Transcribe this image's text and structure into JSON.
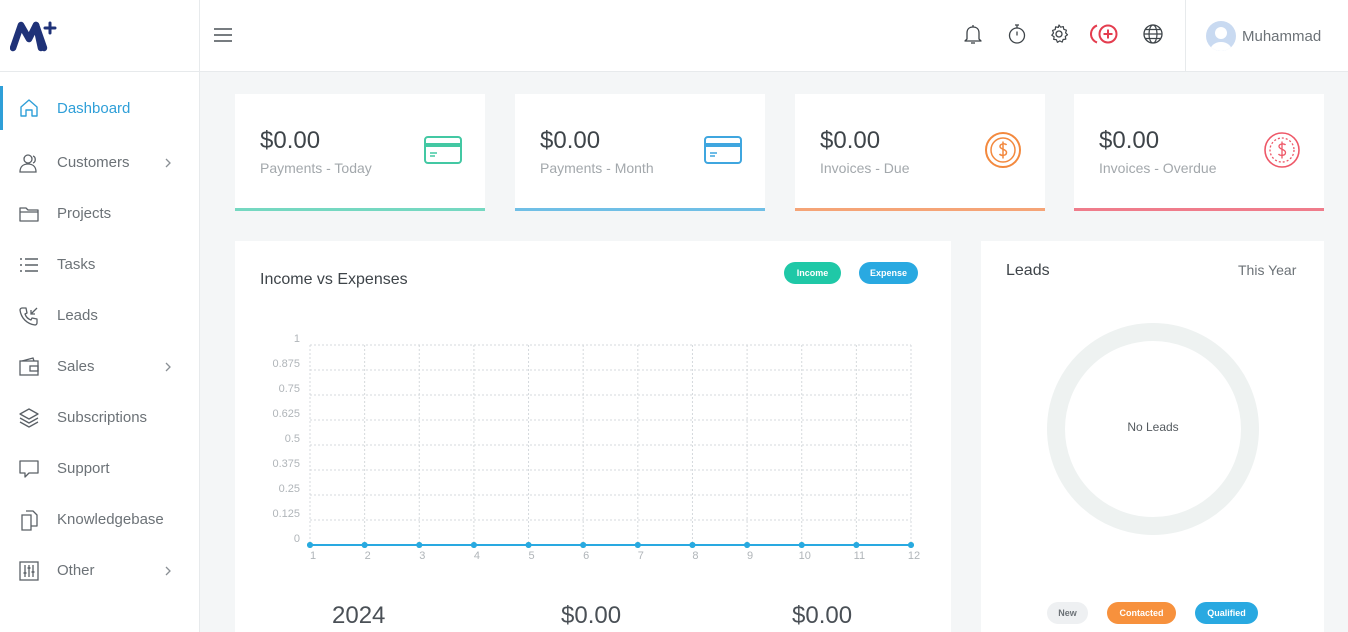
{
  "app": {
    "logo_alt": "brand-logo"
  },
  "sidebar": {
    "items": [
      {
        "label": "Dashboard",
        "icon": "home-icon",
        "active": true,
        "has_submenu": false
      },
      {
        "label": "Customers",
        "icon": "users-icon",
        "active": false,
        "has_submenu": true
      },
      {
        "label": "Projects",
        "icon": "folder-icon",
        "active": false,
        "has_submenu": false
      },
      {
        "label": "Tasks",
        "icon": "list-icon",
        "active": false,
        "has_submenu": false
      },
      {
        "label": "Leads",
        "icon": "phone-incoming-icon",
        "active": false,
        "has_submenu": false
      },
      {
        "label": "Sales",
        "icon": "wallet-icon",
        "active": false,
        "has_submenu": true
      },
      {
        "label": "Subscriptions",
        "icon": "layers-icon",
        "active": false,
        "has_submenu": false
      },
      {
        "label": "Support",
        "icon": "chat-icon",
        "active": false,
        "has_submenu": false
      },
      {
        "label": "Knowledgebase",
        "icon": "document-icon",
        "active": false,
        "has_submenu": false
      },
      {
        "label": "Other",
        "icon": "sliders-icon",
        "active": false,
        "has_submenu": true
      }
    ]
  },
  "topbar": {
    "icons": [
      "bell-icon",
      "timer-icon",
      "gear-icon",
      "add-circle-icon",
      "globe-icon"
    ],
    "user_name": "Muhammad"
  },
  "stats": [
    {
      "value": "$0.00",
      "label": "Payments - Today",
      "icon": "credit-card-icon",
      "color": "#43c8a3"
    },
    {
      "value": "$0.00",
      "label": "Payments - Month",
      "icon": "credit-card-icon",
      "color": "#3fa6df"
    },
    {
      "value": "$0.00",
      "label": "Invoices - Due",
      "icon": "dollar-coin-icon",
      "color": "#f3893e"
    },
    {
      "value": "$0.00",
      "label": "Invoices - Overdue",
      "icon": "dollar-coin-icon",
      "color": "#ee5868"
    }
  ],
  "income_panel": {
    "title": "Income vs Expenses",
    "legend": [
      {
        "label": "Income",
        "color": "#1fc8a7"
      },
      {
        "label": "Expense",
        "color": "#29a9e1"
      }
    ],
    "summary": {
      "year": "2024",
      "income_total": "$0.00",
      "expense_total": "$0.00"
    }
  },
  "chart_data": {
    "type": "line",
    "title": "Income vs Expenses",
    "x": [
      1,
      2,
      3,
      4,
      5,
      6,
      7,
      8,
      9,
      10,
      11,
      12
    ],
    "y_ticks": [
      "1",
      "0.875",
      "0.75",
      "0.625",
      "0.5",
      "0.375",
      "0.25",
      "0.125",
      "0"
    ],
    "ylim": [
      0,
      1
    ],
    "grid": true,
    "legend_position": "top-right",
    "series": [
      {
        "name": "Income",
        "color": "#1fc8a7",
        "values": [
          0,
          0,
          0,
          0,
          0,
          0,
          0,
          0,
          0,
          0,
          0,
          0
        ]
      },
      {
        "name": "Expense",
        "color": "#29a9e1",
        "values": [
          0,
          0,
          0,
          0,
          0,
          0,
          0,
          0,
          0,
          0,
          0,
          0
        ]
      }
    ]
  },
  "leads_panel": {
    "title": "Leads",
    "range": "This Year",
    "empty_label": "No Leads",
    "legend": [
      {
        "label": "New",
        "bg": "#eef0f2",
        "fg": "#6c7277"
      },
      {
        "label": "Contacted",
        "bg": "#f7913d",
        "fg": "#ffffff"
      },
      {
        "label": "Qualified",
        "bg": "#29a9e1",
        "fg": "#ffffff"
      }
    ]
  }
}
